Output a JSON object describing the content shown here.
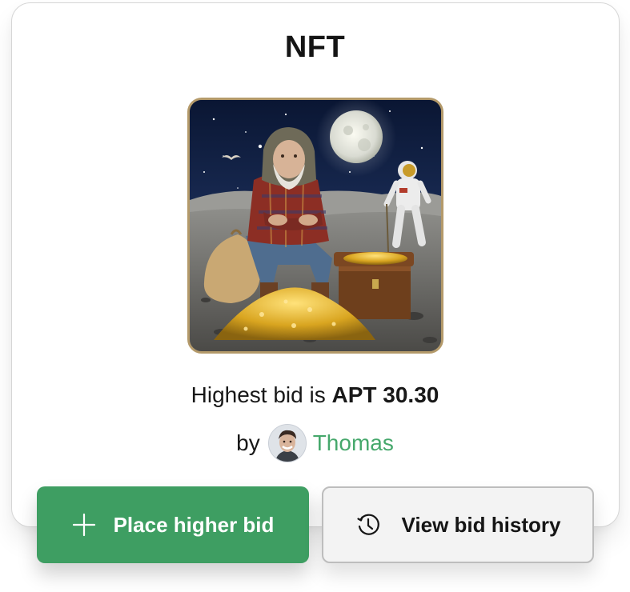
{
  "card": {
    "title": "NFT"
  },
  "artwork": {
    "subject": "old bearded man in hooded flannel jacket sitting on moon surface beside pile of gold coins and treasure chest, astronaut in background, full moon in starry sky",
    "frame_color": "#b49a6a"
  },
  "bid": {
    "prefix": "Highest bid is",
    "amount": "APT 30.30"
  },
  "owner": {
    "by_label": "by",
    "name": "Thomas",
    "link_color": "#46a86c"
  },
  "actions": {
    "place_bid_label": "Place higher bid",
    "place_bid_icon": "plus-icon",
    "history_label": "View bid history",
    "history_icon": "history-clock-icon"
  },
  "colors": {
    "primary": "#3e9e62",
    "secondary_bg": "#f3f3f3"
  }
}
